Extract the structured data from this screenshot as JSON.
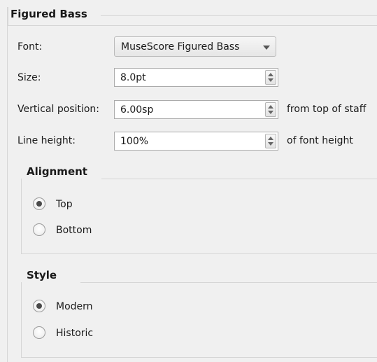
{
  "figured_bass": {
    "title": "Figured Bass",
    "font": {
      "label": "Font:",
      "value": "MuseScore Figured Bass"
    },
    "size": {
      "label": "Size:",
      "value": "8.0pt"
    },
    "vertical_position": {
      "label": "Vertical position:",
      "value": "6.00sp",
      "suffix": "from top of staff"
    },
    "line_height": {
      "label": "Line height:",
      "value": "100%",
      "suffix": "of font height"
    }
  },
  "alignment": {
    "title": "Alignment",
    "options": [
      {
        "label": "Top",
        "checked": true
      },
      {
        "label": "Bottom",
        "checked": false
      }
    ]
  },
  "style": {
    "title": "Style",
    "options": [
      {
        "label": "Modern",
        "checked": true
      },
      {
        "label": "Historic",
        "checked": false
      }
    ]
  },
  "icons": {
    "combo": "chevron-down-icon",
    "spin_up": "spin-up-icon",
    "spin_down": "spin-down-icon"
  }
}
